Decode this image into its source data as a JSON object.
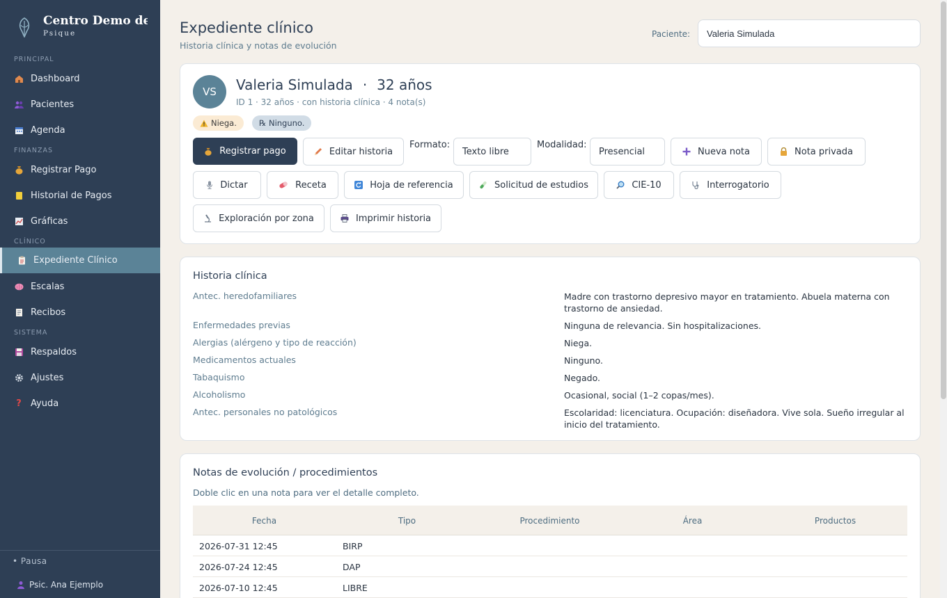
{
  "sidebar": {
    "brand_title": "Centro Demo de Psicología",
    "brand_sub": "Psique",
    "sections": {
      "principal": "PRINCIPAL",
      "finanzas": "FINANZAS",
      "clinico": "CLÍNICO",
      "sistema": "SISTEMA"
    },
    "items": [
      {
        "label": "Dashboard",
        "icon": "house-icon"
      },
      {
        "label": "Pacientes",
        "icon": "people-icon"
      },
      {
        "label": "Agenda",
        "icon": "calendar-icon"
      },
      {
        "label": "Registrar Pago",
        "icon": "money-bag-icon"
      },
      {
        "label": "Historial de Pagos",
        "icon": "ledger-icon"
      },
      {
        "label": "Gráficas",
        "icon": "chart-icon"
      },
      {
        "label": "Expediente Clínico",
        "icon": "clipboard-icon"
      },
      {
        "label": "Escalas",
        "icon": "brain-icon"
      },
      {
        "label": "Recibos",
        "icon": "receipt-icon"
      },
      {
        "label": "Respaldos",
        "icon": "floppy-icon"
      },
      {
        "label": "Ajustes",
        "icon": "gear-icon"
      },
      {
        "label": "Ayuda",
        "icon": "question-icon"
      }
    ],
    "pause": "• Pausa",
    "user": "Psic. Ana Ejemplo"
  },
  "header": {
    "title": "Expediente clínico",
    "subtitle": "Historia clínica y notas de evolución",
    "patient_label": "Paciente:",
    "patient_value": "Valeria Simulada"
  },
  "patient_card": {
    "initials": "VS",
    "name": "Valeria Simulada",
    "age": "32 años",
    "meta": "ID 1 · 32 años · con historia clínica · 4 nota(s)",
    "badge_allergy": "Niega.",
    "badge_meds": "℞ Ninguno.",
    "buttons": {
      "registrar_pago": "Registrar pago",
      "editar_historia": "Editar historia",
      "formato_label": "Formato:",
      "formato_value": "Texto libre",
      "modalidad_label": "Modalidad:",
      "modalidad_value": "Presencial",
      "nueva_nota": "Nueva nota",
      "nota_privada": "Nota privada",
      "dictar": "Dictar",
      "receta": "Receta",
      "hoja_referencia": "Hoja de referencia",
      "solicitud_estudios": "Solicitud de estudios",
      "cie10": "CIE-10",
      "interrogatorio": "Interrogatorio",
      "exploracion": "Exploración por zona",
      "imprimir": "Imprimir historia"
    }
  },
  "history": {
    "title": "Historia clínica",
    "rows": [
      {
        "key": "Antec. heredofamiliares",
        "value": "Madre con trastorno depresivo mayor en tratamiento. Abuela materna con trastorno de ansiedad."
      },
      {
        "key": "Enfermedades previas",
        "value": "Ninguna de relevancia. Sin hospitalizaciones."
      },
      {
        "key": "Alergias (alérgeno y tipo de reacción)",
        "value": "Niega."
      },
      {
        "key": "Medicamentos actuales",
        "value": "Ninguno."
      },
      {
        "key": "Tabaquismo",
        "value": "Negado."
      },
      {
        "key": "Alcoholismo",
        "value": "Ocasional, social (1–2 copas/mes)."
      },
      {
        "key": "Antec. personales no patológicos",
        "value": "Escolaridad: licenciatura. Ocupación: diseñadora. Vive sola. Sueño irregular al inicio del tratamiento."
      }
    ]
  },
  "notes": {
    "title": "Notas de evolución / procedimientos",
    "hint": "Doble clic en una nota para ver el detalle completo.",
    "columns": [
      "Fecha",
      "Tipo",
      "Procedimiento",
      "Área",
      "Productos"
    ],
    "rows": [
      {
        "fecha": "2026-07-31 12:45",
        "tipo": "BIRP"
      },
      {
        "fecha": "2026-07-24 12:45",
        "tipo": "DAP"
      },
      {
        "fecha": "2026-07-10 12:45",
        "tipo": "LIBRE"
      }
    ]
  }
}
